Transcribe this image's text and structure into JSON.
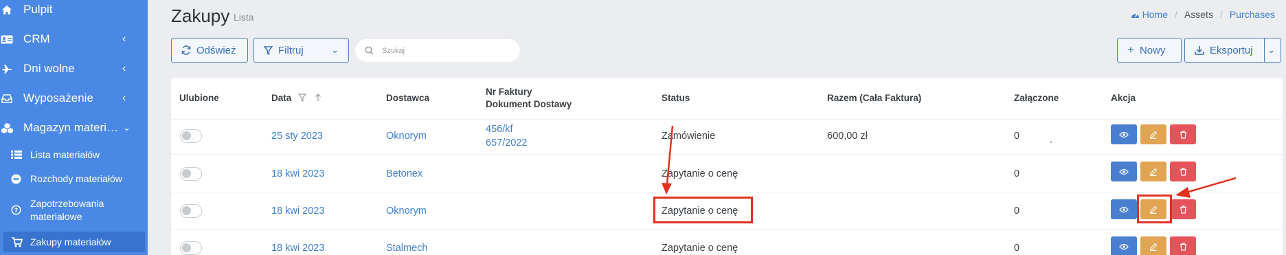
{
  "sidebar": {
    "items": [
      {
        "label": "Pulpit",
        "icon": "home-icon"
      },
      {
        "label": "CRM",
        "icon": "id-card-icon"
      },
      {
        "label": "Dni wolne",
        "icon": "plane-icon"
      },
      {
        "label": "Wyposażenie",
        "icon": "inbox-icon"
      },
      {
        "label": "Magazyn materiał…",
        "icon": "cubes-icon"
      }
    ],
    "subitems": [
      {
        "label": "Lista materiałów",
        "icon": "list-icon"
      },
      {
        "label": "Rozchody materiałów",
        "icon": "minus-circle-icon"
      },
      {
        "label": "Zapotrzebowania materiałowe",
        "line1": "Zapotrzebowania",
        "line2": "materiałowe",
        "icon": "question-circle-icon"
      },
      {
        "label": "Zakupy materiałów",
        "icon": "cart-icon"
      }
    ]
  },
  "header": {
    "title": "Zakupy",
    "subtitle": "Lista",
    "breadcrumb": {
      "home": "Home",
      "assets": "Assets",
      "current": "Purchases"
    }
  },
  "toolbar": {
    "refresh": "Odśwież",
    "filter": "Filtruj",
    "search_placeholder": "Szukaj",
    "new": "Nowy",
    "export": "Eksportuj"
  },
  "table": {
    "headers": {
      "fav": "Ulubione",
      "date": "Data",
      "supplier": "Dostawca",
      "invoice_l1": "Nr Faktury",
      "invoice_l2": "Dokument Dostawy",
      "status": "Status",
      "total": "Razem (Cała Faktura)",
      "attached": "Załączone",
      "action": "Akcja"
    },
    "rows": [
      {
        "date": "25 sty 2023",
        "supplier": "Oknorym",
        "invoice": "456/kf",
        "delivery": "657/2022",
        "status": "Zamówienie",
        "total": "600,00 zł",
        "attached": "0"
      },
      {
        "date": "18 kwi 2023",
        "supplier": "Betonex",
        "invoice": "",
        "delivery": "",
        "status": "Zapytanie o cenę",
        "total": "",
        "attached": "0"
      },
      {
        "date": "18 kwi 2023",
        "supplier": "Oknorym",
        "invoice": "",
        "delivery": "",
        "status": "Zapytanie o cenę",
        "total": "",
        "attached": "0"
      },
      {
        "date": "18 kwi 2023",
        "supplier": "Stalmech",
        "invoice": "",
        "delivery": "",
        "status": "Zapytanie o cenę",
        "total": "",
        "attached": "0"
      }
    ]
  },
  "colors": {
    "sidebar": "#4a88e6",
    "link": "#3f7fcf",
    "view_btn": "#4a7fcf",
    "edit_btn": "#e1a453",
    "delete_btn": "#e4545a",
    "annotation": "#e0321f"
  }
}
